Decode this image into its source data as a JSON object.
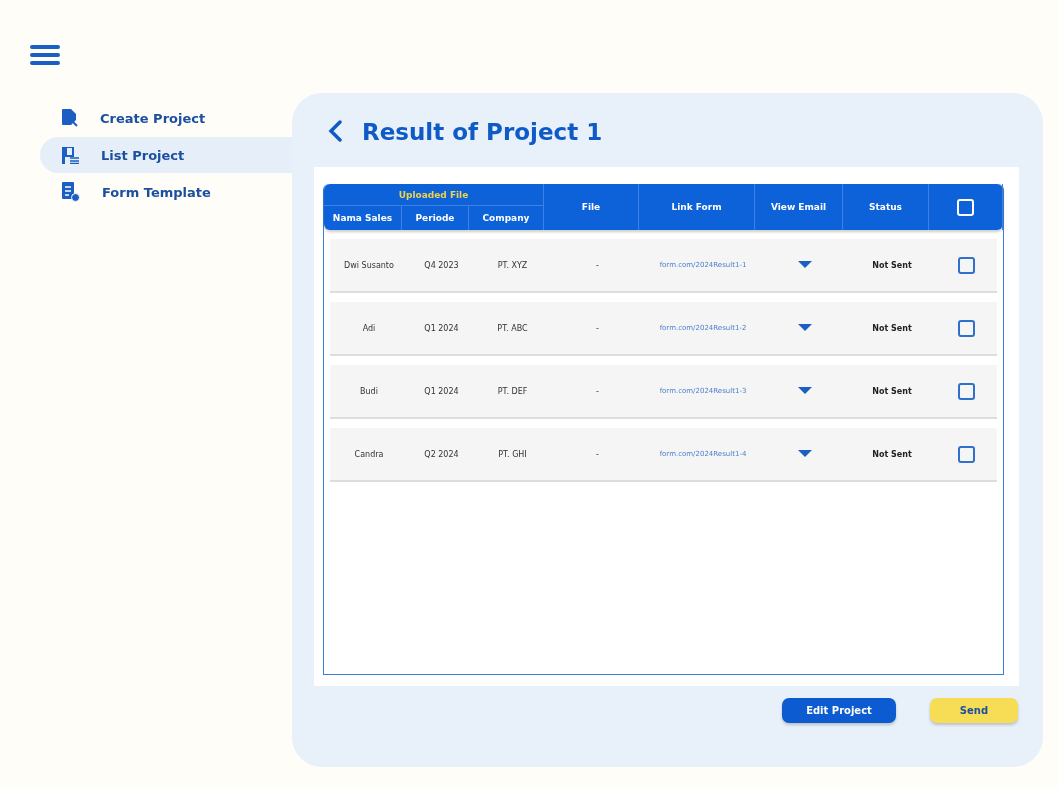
{
  "sidebar": {
    "items": [
      {
        "label": "Create Project",
        "kind": "create",
        "selected": false
      },
      {
        "label": "List Project",
        "kind": "list",
        "selected": true
      },
      {
        "label": "Form Template",
        "kind": "form",
        "selected": false
      }
    ]
  },
  "title": "Result of Project 1",
  "table": {
    "group_header": "Uploaded File",
    "columns": [
      "Nama Sales",
      "Periode",
      "Company",
      "File",
      "Link Form",
      "View Email",
      "Status"
    ],
    "header_checked": false,
    "rows": [
      {
        "cells": [
          "Dwi Susanto",
          "Q4 2023",
          "PT. XYZ",
          "-",
          "form.com/2024Result1-1"
        ],
        "status": "Not Sent",
        "checked": false
      },
      {
        "cells": [
          "Adi",
          "Q1 2024",
          "PT. ABC",
          "-",
          "form.com/2024Result1-2"
        ],
        "status": "Not Sent",
        "checked": false
      },
      {
        "cells": [
          "Budi",
          "Q1 2024",
          "PT. DEF",
          "-",
          "form.com/2024Result1-3"
        ],
        "status": "Not Sent",
        "checked": false
      },
      {
        "cells": [
          "Candra",
          "Q2 2024",
          "PT. GHI",
          "-",
          "form.com/2024Result1-4"
        ],
        "status": "Not Sent",
        "checked": false
      }
    ]
  },
  "buttons": [
    {
      "label": "Edit Project",
      "kind": "primary"
    },
    {
      "label": "Send",
      "kind": "accent"
    }
  ]
}
